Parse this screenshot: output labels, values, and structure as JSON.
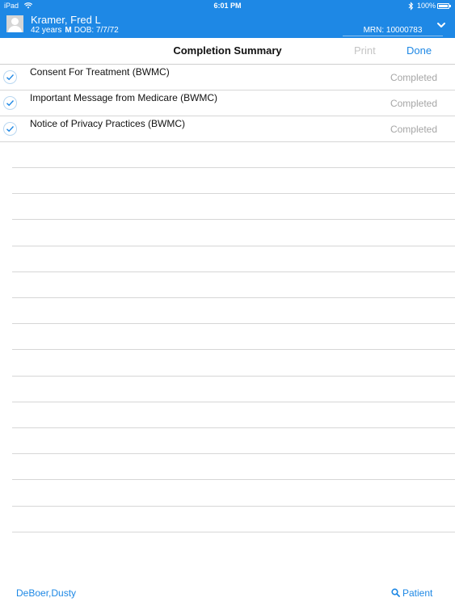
{
  "status_bar": {
    "carrier": "iPad",
    "time": "6:01 PM",
    "bluetooth_icon": "bluetooth-icon",
    "battery": "100%"
  },
  "patient": {
    "name": "Kramer, Fred L",
    "age": "42 years",
    "sex": "M",
    "dob": "DOB: 7/7/72",
    "mrn": "MRN: 10000783"
  },
  "nav": {
    "title": "Completion Summary",
    "print_label": "Print",
    "done_label": "Done"
  },
  "documents": [
    {
      "title": "Consent For Treatment (BWMC)",
      "status": "Completed"
    },
    {
      "title": "Important Message from Medicare (BWMC)",
      "status": "Completed"
    },
    {
      "title": "Notice of Privacy Practices (BWMC)",
      "status": "Completed"
    }
  ],
  "footer": {
    "user": "DeBoer,Dusty",
    "patient_label": "Patient"
  },
  "colors": {
    "accent": "#1e88e5",
    "muted": "#a6a6a6"
  }
}
